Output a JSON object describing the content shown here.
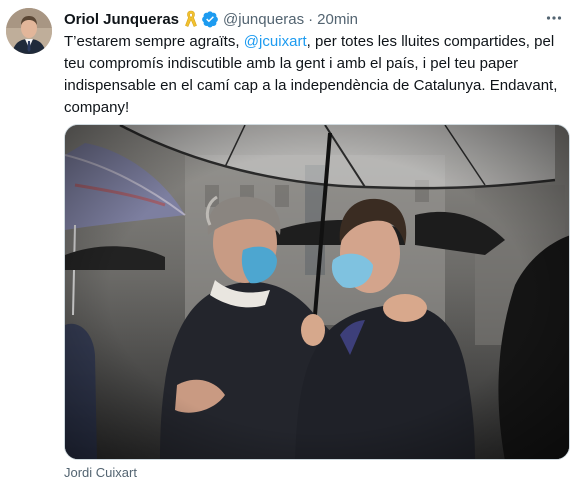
{
  "tweet": {
    "display_name": "Oriol Junqueras",
    "handle": "@junqueras",
    "separator": "·",
    "time": "20min",
    "text_part1": "T’estarem sempre agraïts, ",
    "mention": "@jcuixart",
    "text_part2": ", per totes les lluites compartides, pel teu compromís indiscutible amb la gent i amb el país, i pel teu paper indispensable en el camí cap a la independència de Catalunya. Endavant, company!",
    "tagged_user": "Jordi Cuixart"
  },
  "icons": {
    "ribbon": "yellow-ribbon-icon",
    "verified": "verified-badge-icon",
    "more": "more-options-icon"
  },
  "colors": {
    "link": "#1d9bf0",
    "secondary_text": "#536471",
    "ribbon": "#f2c230",
    "verified": "#1d9bf0"
  }
}
